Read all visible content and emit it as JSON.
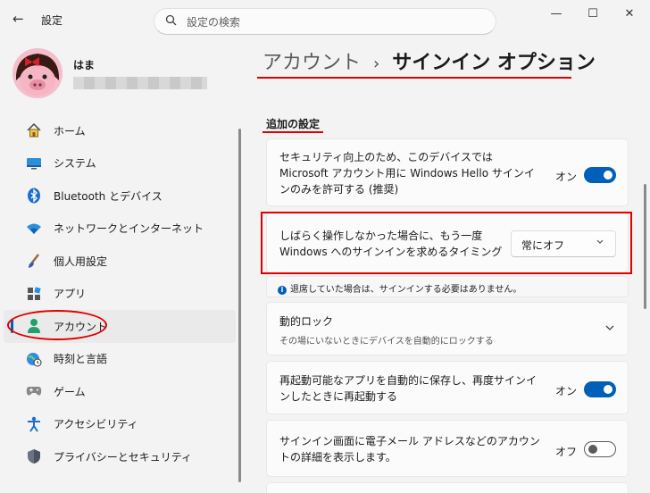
{
  "window": {
    "title": "設定",
    "back": "←",
    "minimize": "—",
    "maximize": "☐",
    "close": "✕"
  },
  "search": {
    "placeholder": "設定の検索",
    "icon": "search-icon"
  },
  "user": {
    "name": "はま"
  },
  "sidebar": {
    "items": [
      {
        "label": "ホーム",
        "icon": "home-icon"
      },
      {
        "label": "システム",
        "icon": "monitor-icon"
      },
      {
        "label": "Bluetooth とデバイス",
        "icon": "bluetooth-icon"
      },
      {
        "label": "ネットワークとインターネット",
        "icon": "wifi-icon"
      },
      {
        "label": "個人用設定",
        "icon": "brush-icon"
      },
      {
        "label": "アプリ",
        "icon": "apps-icon"
      },
      {
        "label": "アカウント",
        "icon": "person-icon"
      },
      {
        "label": "時刻と言語",
        "icon": "globe-clock-icon"
      },
      {
        "label": "ゲーム",
        "icon": "gamepad-icon"
      },
      {
        "label": "アクセシビリティ",
        "icon": "accessibility-icon"
      },
      {
        "label": "プライバシーとセキュリティ",
        "icon": "shield-icon"
      }
    ],
    "active_index": 6
  },
  "breadcrumb": {
    "parent": "アカウント",
    "separator": "›",
    "current": "サインイン オプション"
  },
  "section": {
    "title": "追加の設定"
  },
  "settings": {
    "hello_only": {
      "text": "セキュリティ向上のため、このデバイスでは Microsoft アカウント用に Windows Hello サインインのみを許可する (推奨)",
      "state": "オン"
    },
    "require_signin": {
      "text": "しばらく操作しなかった場合に、もう一度 Windows へのサインインを求めるタイミング",
      "value": "常にオフ"
    },
    "info": "退席していた場合は、サインインする必要はありません。",
    "dynamic_lock": {
      "title": "動的ロック",
      "description": "その場にいないときにデバイスを自動的にロックする"
    },
    "restart_apps": {
      "text": "再起動可能なアプリを自動的に保存し、再度サインインしたときに再起動する",
      "state": "オン"
    },
    "show_email": {
      "text": "サインイン画面に電子メール アドレスなどのアカウントの詳細を表示します。",
      "state": "オフ"
    }
  },
  "colors": {
    "accent": "#005fb8",
    "annotation": "#e00000",
    "background": "#f3f3f3"
  }
}
